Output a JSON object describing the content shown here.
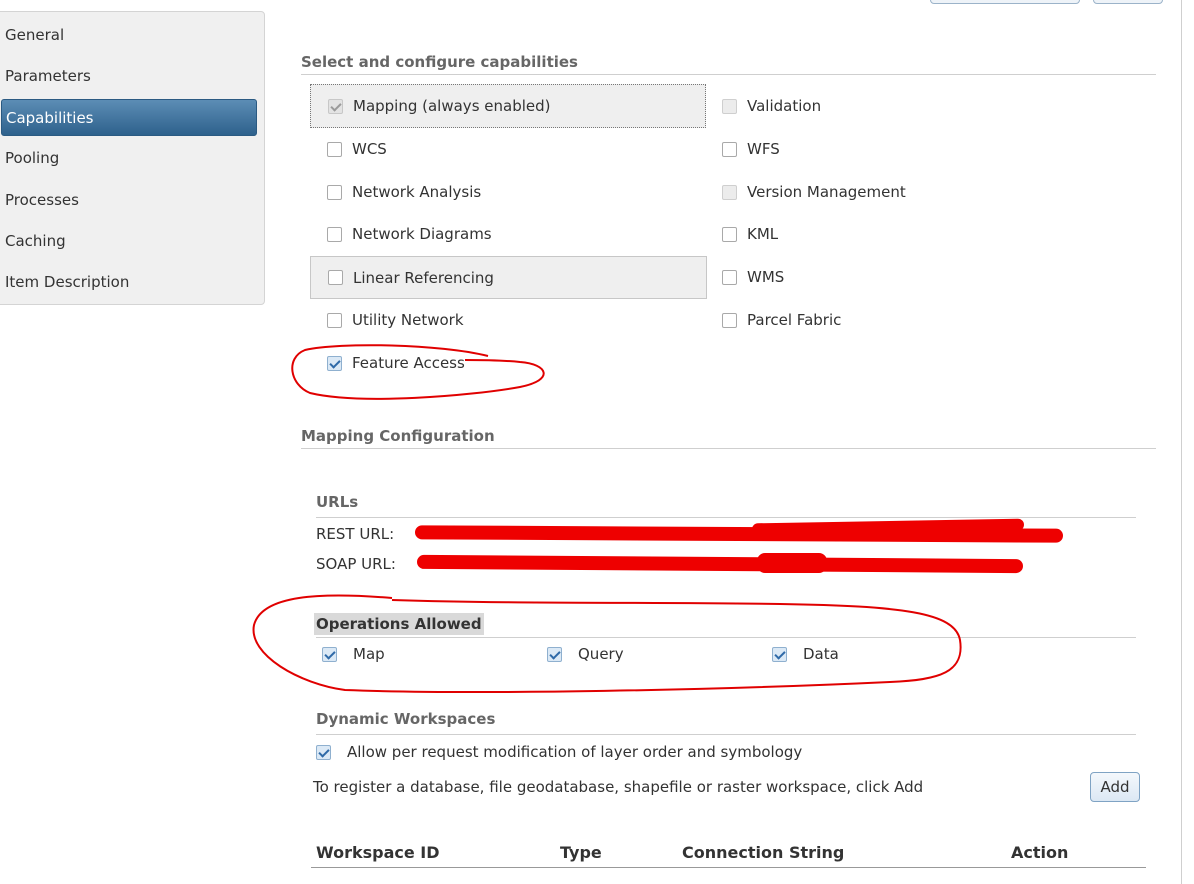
{
  "sidebar": {
    "items": [
      {
        "label": "General",
        "active": false
      },
      {
        "label": "Parameters",
        "active": false
      },
      {
        "label": "Capabilities",
        "active": true
      },
      {
        "label": "Pooling",
        "active": false
      },
      {
        "label": "Processes",
        "active": false
      },
      {
        "label": "Caching",
        "active": false
      },
      {
        "label": "Item Description",
        "active": false
      }
    ]
  },
  "capabilities": {
    "title": "Select and configure capabilities",
    "left": [
      {
        "label": "Mapping (always enabled)",
        "checked": true,
        "disabled": true
      },
      {
        "label": "WCS",
        "checked": false
      },
      {
        "label": "Network Analysis",
        "checked": false
      },
      {
        "label": "Network Diagrams",
        "checked": false
      },
      {
        "label": "Linear Referencing",
        "checked": false
      },
      {
        "label": "Utility Network",
        "checked": false
      },
      {
        "label": "Feature Access",
        "checked": true
      }
    ],
    "right": [
      {
        "label": "Validation",
        "checked": false,
        "disabled": true
      },
      {
        "label": "WFS",
        "checked": false
      },
      {
        "label": "Version Management",
        "checked": false,
        "disabled": true
      },
      {
        "label": "KML",
        "checked": false
      },
      {
        "label": "WMS",
        "checked": false
      },
      {
        "label": "Parcel Fabric",
        "checked": false
      }
    ]
  },
  "mapping_config": {
    "title": "Mapping Configuration",
    "urls_title": "URLs",
    "rest_label": "REST URL:",
    "soap_label": "SOAP URL:",
    "operations_title": "Operations Allowed",
    "operations": [
      {
        "label": "Map",
        "checked": true
      },
      {
        "label": "Query",
        "checked": true
      },
      {
        "label": "Data",
        "checked": true
      }
    ],
    "dynamic_title": "Dynamic Workspaces",
    "dynamic_checkbox": "Allow per request modification of layer order and symbology",
    "register_text": "To register a database, file geodatabase, shapefile or raster workspace, click Add",
    "add_button": "Add",
    "table_headers": [
      "Workspace ID",
      "Type",
      "Connection String",
      "Action"
    ]
  },
  "colors": {
    "accent": "#2e618c",
    "annotation": "#e00000"
  }
}
